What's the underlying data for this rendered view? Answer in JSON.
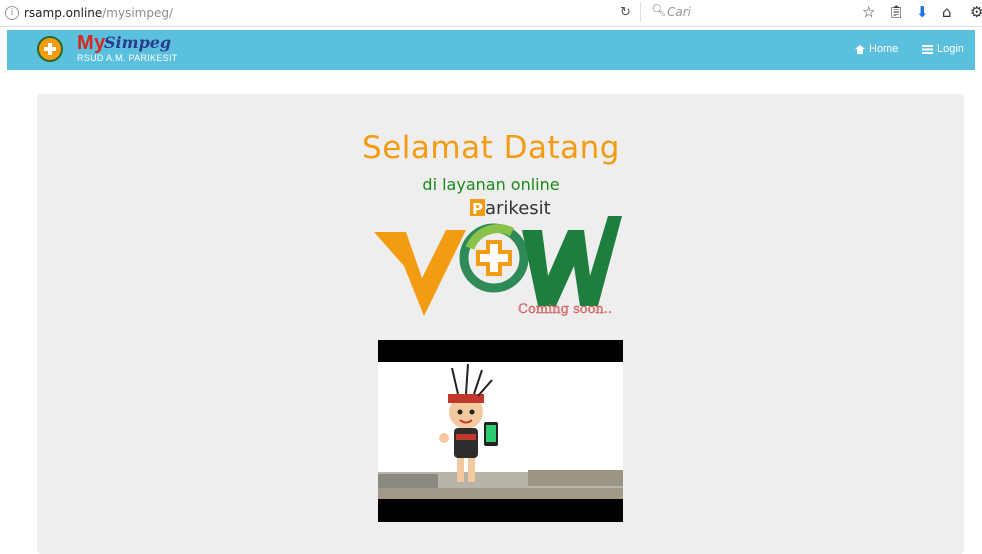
{
  "browser": {
    "url_host": "rsamp.online",
    "url_path": "/mysimpeg/",
    "search_placeholder": "Cari"
  },
  "navbar": {
    "brand_my": "My",
    "brand_simpeg": "Simpeg",
    "brand_sub": "RSUD A.M. PARIKESIT",
    "home_label": "Home",
    "login_label": "Login",
    "bg_color": "#5bc0de"
  },
  "hero": {
    "title": "Selamat Datang",
    "subtitle": "di layanan online",
    "logo_brand": "arikesit",
    "logo_brand_initial": "P",
    "logo_word": "WOW",
    "coming_soon": "Coming soon..",
    "title_color": "#f39c12",
    "subtitle_color": "#1a8a1a"
  },
  "icons": [
    "info-icon",
    "reload-icon",
    "search-icon",
    "star-icon",
    "clipboard-icon",
    "download-icon",
    "home-icon",
    "settings-icon",
    "house-icon",
    "list-icon"
  ]
}
